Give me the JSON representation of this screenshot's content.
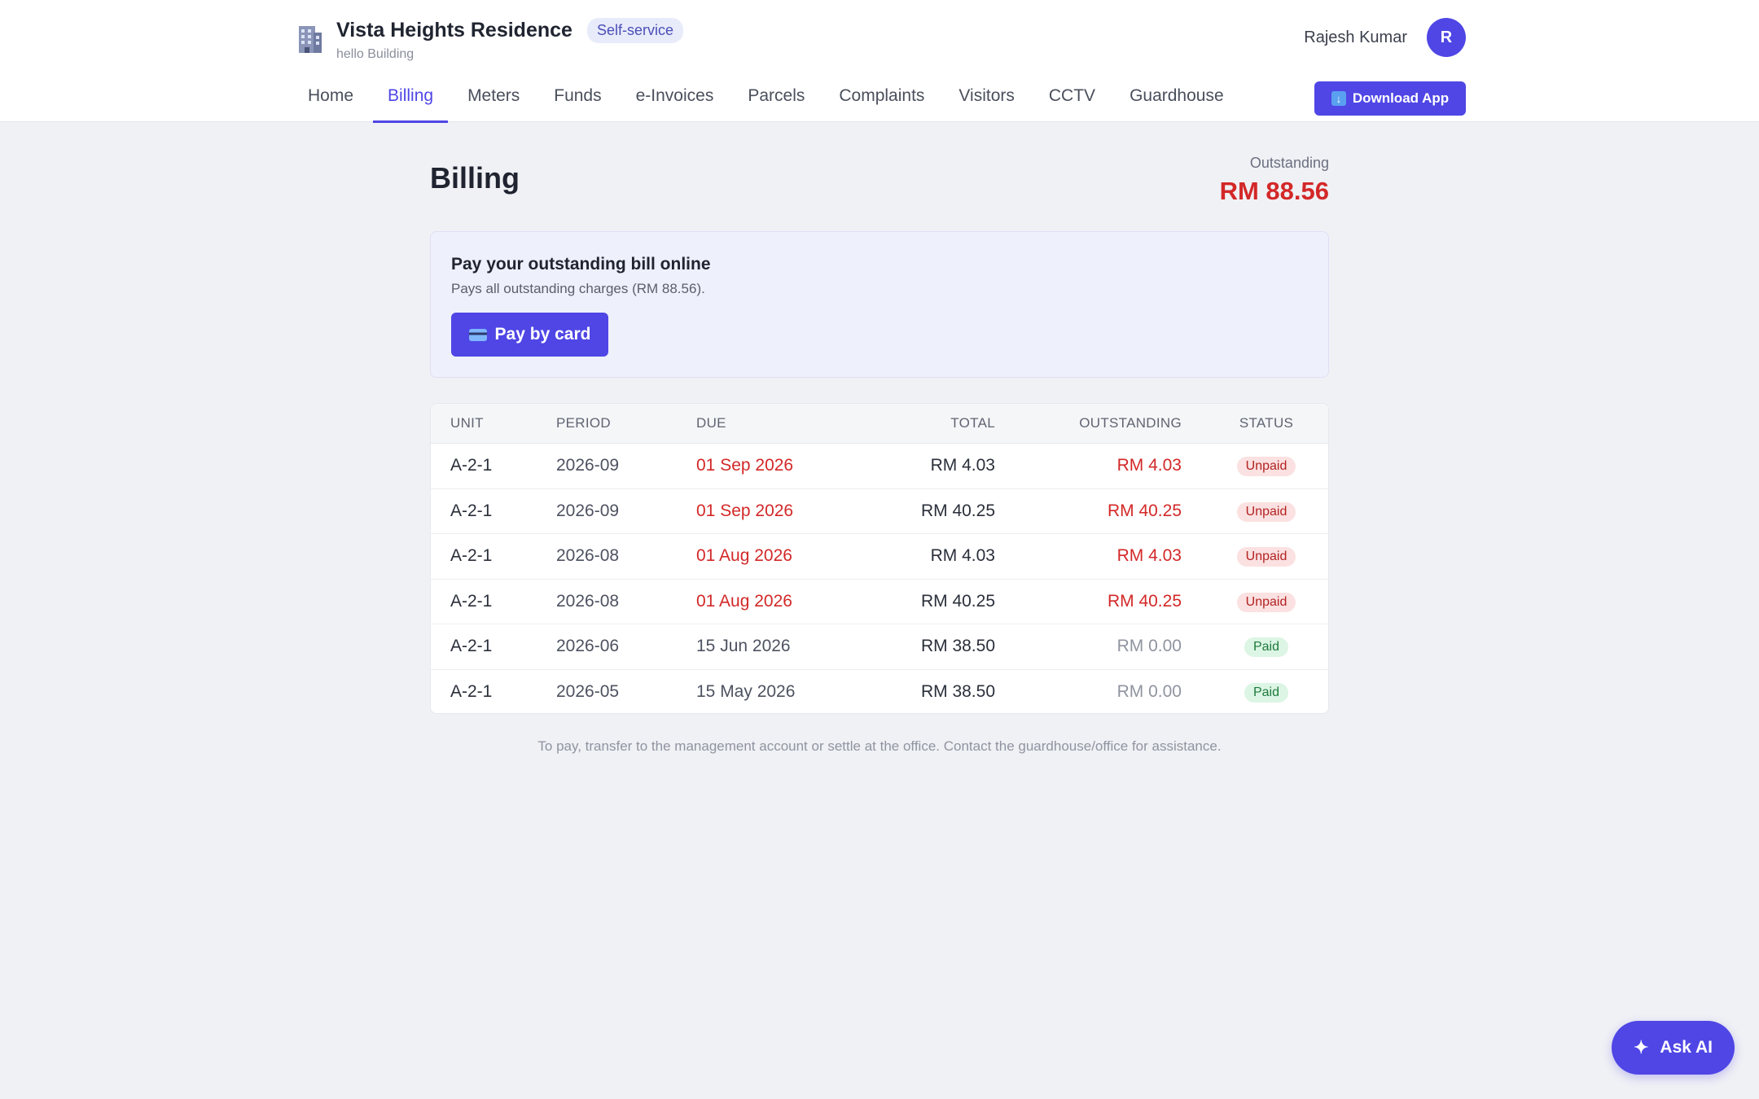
{
  "header": {
    "building_name": "Vista Heights Residence",
    "building_sub": "hello Building",
    "mode_badge": "Self-service",
    "user_name": "Rajesh Kumar",
    "avatar_initial": "R",
    "download_label": "Download App"
  },
  "nav": {
    "items": [
      {
        "label": "Home"
      },
      {
        "label": "Billing",
        "active": true
      },
      {
        "label": "Meters"
      },
      {
        "label": "Funds"
      },
      {
        "label": "e-Invoices"
      },
      {
        "label": "Parcels"
      },
      {
        "label": "Complaints"
      },
      {
        "label": "Visitors"
      },
      {
        "label": "CCTV"
      },
      {
        "label": "Guardhouse"
      }
    ]
  },
  "page": {
    "title": "Billing",
    "outstanding_label": "Outstanding",
    "outstanding_amount": "RM 88.56"
  },
  "pay_panel": {
    "title": "Pay your outstanding bill online",
    "subtitle": "Pays all outstanding charges (RM 88.56).",
    "button_label": "Pay by card"
  },
  "table": {
    "headers": {
      "unit": "UNIT",
      "period": "PERIOD",
      "due": "DUE",
      "total": "TOTAL",
      "outstanding": "OUTSTANDING",
      "status": "STATUS"
    },
    "rows": [
      {
        "unit": "A-2-1",
        "period": "2026-09",
        "due": "01 Sep 2026",
        "total": "RM 4.03",
        "outstanding": "RM 4.03",
        "status": "Unpaid"
      },
      {
        "unit": "A-2-1",
        "period": "2026-09",
        "due": "01 Sep 2026",
        "total": "RM 40.25",
        "outstanding": "RM 40.25",
        "status": "Unpaid"
      },
      {
        "unit": "A-2-1",
        "period": "2026-08",
        "due": "01 Aug 2026",
        "total": "RM 4.03",
        "outstanding": "RM 4.03",
        "status": "Unpaid"
      },
      {
        "unit": "A-2-1",
        "period": "2026-08",
        "due": "01 Aug 2026",
        "total": "RM 40.25",
        "outstanding": "RM 40.25",
        "status": "Unpaid"
      },
      {
        "unit": "A-2-1",
        "period": "2026-06",
        "due": "15 Jun 2026",
        "total": "RM 38.50",
        "outstanding": "RM 0.00",
        "status": "Paid"
      },
      {
        "unit": "A-2-1",
        "period": "2026-05",
        "due": "15 May 2026",
        "total": "RM 38.50",
        "outstanding": "RM 0.00",
        "status": "Paid"
      }
    ]
  },
  "footer_note": "To pay, transfer to the management account or settle at the office. Contact the guardhouse/office for assistance.",
  "ask_ai_label": "Ask AI",
  "colors": {
    "accent": "#4f46e5",
    "danger": "#d32828",
    "background": "#f0f1f5"
  },
  "icons": {
    "brand": "building-icon",
    "download": "download-arrow-icon",
    "pay": "credit-card-icon",
    "ask_ai": "sparkle-icon"
  }
}
